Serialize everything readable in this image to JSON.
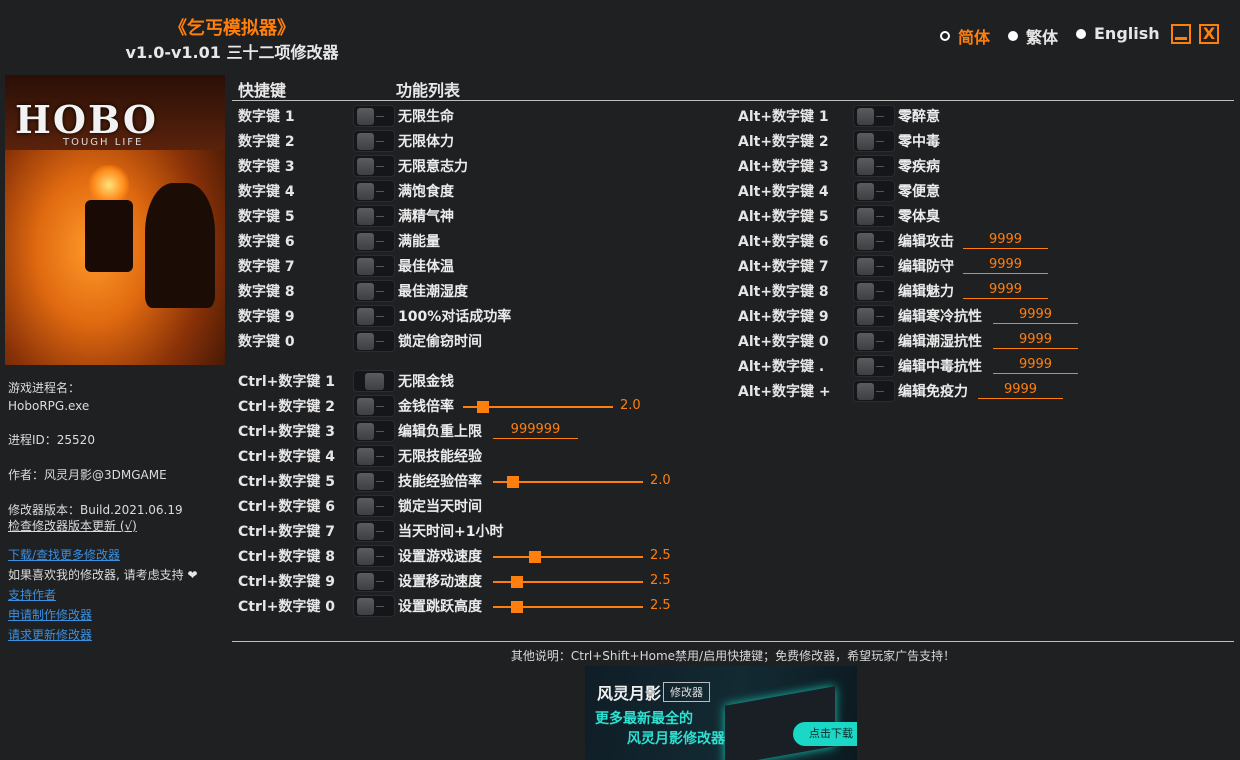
{
  "header": {
    "game_title": "《乞丐模拟器》",
    "subtitle": "v1.0-v1.01 三十二项修改器"
  },
  "languages": [
    {
      "label": "简体",
      "selected": true
    },
    {
      "label": "繁体",
      "selected": false
    },
    {
      "label": "English",
      "selected": false
    }
  ],
  "window_controls": {
    "minimize_icon": "minimize-icon",
    "close_label": "X"
  },
  "cover": {
    "logo": "HOBO",
    "sublogo": "TOUGH LIFE"
  },
  "sidebar": {
    "process_label": "游戏进程名：",
    "process_name": "HoboRPG.exe",
    "pid": "进程ID：25520",
    "author": "作者：风灵月影@3DMGAME",
    "version": "修改器版本：Build.2021.06.19",
    "check_update": "检查修改器版本更新 (√)",
    "download_more": "下载/查找更多修改器",
    "support_text": "如果喜欢我的修改器, 请考虑支持",
    "support_heart": "❤",
    "support_author": "支持作者",
    "request_make": "申请制作修改器",
    "request_update": "请求更新修改器"
  },
  "columns": {
    "hotkey": "快捷键",
    "functions": "功能列表"
  },
  "left_options": [
    {
      "key": "数字键 1",
      "name": "无限生命",
      "on": false
    },
    {
      "key": "数字键 2",
      "name": "无限体力",
      "on": false
    },
    {
      "key": "数字键 3",
      "name": "无限意志力",
      "on": false
    },
    {
      "key": "数字键 4",
      "name": "满饱食度",
      "on": false
    },
    {
      "key": "数字键 5",
      "name": "满精气神",
      "on": false
    },
    {
      "key": "数字键 6",
      "name": "满能量",
      "on": false
    },
    {
      "key": "数字键 7",
      "name": "最佳体温",
      "on": false
    },
    {
      "key": "数字键 8",
      "name": "最佳潮湿度",
      "on": false
    },
    {
      "key": "数字键 9",
      "name": "100%对话成功率",
      "on": false
    },
    {
      "key": "数字键 0",
      "name": "锁定偷窃时间",
      "on": false
    }
  ],
  "ctrl_options": [
    {
      "key": "Ctrl+数字键 1",
      "name": "无限金钱",
      "type": "button"
    },
    {
      "key": "Ctrl+数字键 2",
      "name": "金钱倍率",
      "type": "slider",
      "value": "2.0",
      "fraction": 0.1
    },
    {
      "key": "Ctrl+数字键 3",
      "name": "编辑负重上限",
      "type": "input",
      "value": "999999"
    },
    {
      "key": "Ctrl+数字键 4",
      "name": "无限技能经验",
      "type": "toggle"
    },
    {
      "key": "Ctrl+数字键 5",
      "name": "技能经验倍率",
      "type": "slider",
      "value": "2.0",
      "fraction": 0.1
    },
    {
      "key": "Ctrl+数字键 6",
      "name": "锁定当天时间",
      "type": "toggle"
    },
    {
      "key": "Ctrl+数字键 7",
      "name": "当天时间+1小时",
      "type": "toggle"
    },
    {
      "key": "Ctrl+数字键 8",
      "name": "设置游戏速度",
      "type": "slider",
      "value": "2.5",
      "fraction": 0.26
    },
    {
      "key": "Ctrl+数字键 9",
      "name": "设置移动速度",
      "type": "slider",
      "value": "2.5",
      "fraction": 0.13
    },
    {
      "key": "Ctrl+数字键 0",
      "name": "设置跳跃高度",
      "type": "slider",
      "value": "2.5",
      "fraction": 0.13
    }
  ],
  "alt_options": [
    {
      "key": "Alt+数字键 1",
      "name": "零醉意"
    },
    {
      "key": "Alt+数字键 2",
      "name": "零中毒"
    },
    {
      "key": "Alt+数字键 3",
      "name": "零疾病"
    },
    {
      "key": "Alt+数字键 4",
      "name": "零便意"
    },
    {
      "key": "Alt+数字键 5",
      "name": "零体臭"
    },
    {
      "key": "Alt+数字键 6",
      "name": "编辑攻击",
      "value": "9999"
    },
    {
      "key": "Alt+数字键 7",
      "name": "编辑防守",
      "value": "9999"
    },
    {
      "key": "Alt+数字键 8",
      "name": "编辑魅力",
      "value": "9999"
    },
    {
      "key": "Alt+数字键 9",
      "name": "编辑寒冷抗性",
      "value": "9999"
    },
    {
      "key": "Alt+数字键 0",
      "name": "编辑潮湿抗性",
      "value": "9999"
    },
    {
      "key": "Alt+数字键 .",
      "name": "编辑中毒抗性",
      "value": "9999"
    },
    {
      "key": "Alt+数字键 +",
      "name": "编辑免疫力",
      "value": "9999"
    }
  ],
  "footer": {
    "note": "其他说明：Ctrl+Shift+Home禁用/启用快捷键；免费修改器，希望玩家广告支持！"
  },
  "ad": {
    "brand": "风灵月影",
    "tag": "修改器",
    "line1": "更多最新最全的",
    "line2": "风灵月影修改器",
    "download": "点击下载"
  },
  "colors": {
    "accent": "#ff7f0e",
    "background": "#1f2022",
    "link": "#3b8fe0",
    "ad_accent": "#1ad7c6"
  }
}
